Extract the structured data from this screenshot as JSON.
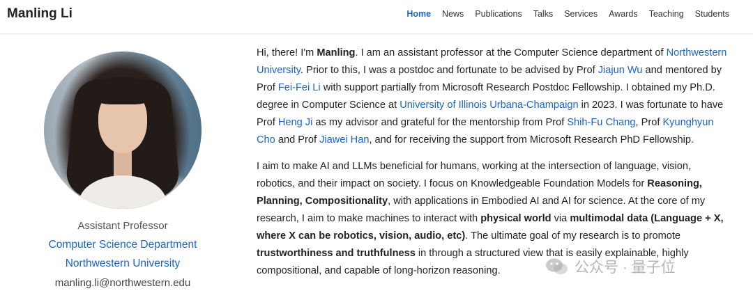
{
  "header": {
    "site_title": "Manling Li",
    "nav": [
      "Home",
      "News",
      "Publications",
      "Talks",
      "Services",
      "Awards",
      "Teaching",
      "Students"
    ],
    "active": "Home"
  },
  "sidebar": {
    "role": "Assistant Professor",
    "department": "Computer Science Department",
    "university": "Northwestern University",
    "email": "manling.li@northwestern.edu"
  },
  "bio": {
    "p1": [
      {
        "t": "Hi, there! I'm "
      },
      {
        "t": "Manling",
        "b": true
      },
      {
        "t": ". I am an assistant professor at the Computer Science department of "
      },
      {
        "t": "Northwestern University",
        "link": true
      },
      {
        "t": ". Prior to this, I was a postdoc and fortunate to be advised by Prof "
      },
      {
        "t": "Jiajun Wu",
        "link": true
      },
      {
        "t": " and mentored by Prof "
      },
      {
        "t": "Fei-Fei Li",
        "link": true
      },
      {
        "t": " with support partially from Microsoft Research Postdoc Fellowship. I obtained my Ph.D. degree in Computer Science at "
      },
      {
        "t": "University of Illinois Urbana-Champaign",
        "link": true
      },
      {
        "t": " in 2023. I was fortunate to have Prof "
      },
      {
        "t": "Heng Ji",
        "link": true
      },
      {
        "t": " as my advisor and grateful for the mentorship from Prof "
      },
      {
        "t": "Shih-Fu Chang",
        "link": true
      },
      {
        "t": ", Prof "
      },
      {
        "t": "Kyunghyun Cho",
        "link": true
      },
      {
        "t": " and Prof "
      },
      {
        "t": "Jiawei Han",
        "link": true
      },
      {
        "t": ", and for receiving the support from Microsoft Research PhD Fellowship."
      }
    ],
    "p2": [
      {
        "t": "I aim to make AI and LLMs beneficial for humans, working at the intersection of language, vision, robotics, and their impact on society. I focus on Knowledgeable Foundation Models for "
      },
      {
        "t": "Reasoning, Planning, Compositionality",
        "b": true
      },
      {
        "t": ", with applications in Embodied AI and AI for science. At the core of my research, I aim to make machines to interact with "
      },
      {
        "t": "physical world",
        "b": true
      },
      {
        "t": " via "
      },
      {
        "t": "multimodal data (Language + X, where X can be robotics, vision, audio, etc)",
        "b": true
      },
      {
        "t": ". The ultimate goal of my research is to promote "
      },
      {
        "t": "trustworthiness and truthfulness",
        "b": true
      },
      {
        "t": " in through a structured view that is easily explainable, highly compositional, and capable of long-horizon reasoning."
      }
    ]
  },
  "watermark": {
    "text": "公众号 · 量子位",
    "icon": "wechat-icon"
  },
  "colors": {
    "link": "#1a64c8",
    "text": "#222222"
  }
}
